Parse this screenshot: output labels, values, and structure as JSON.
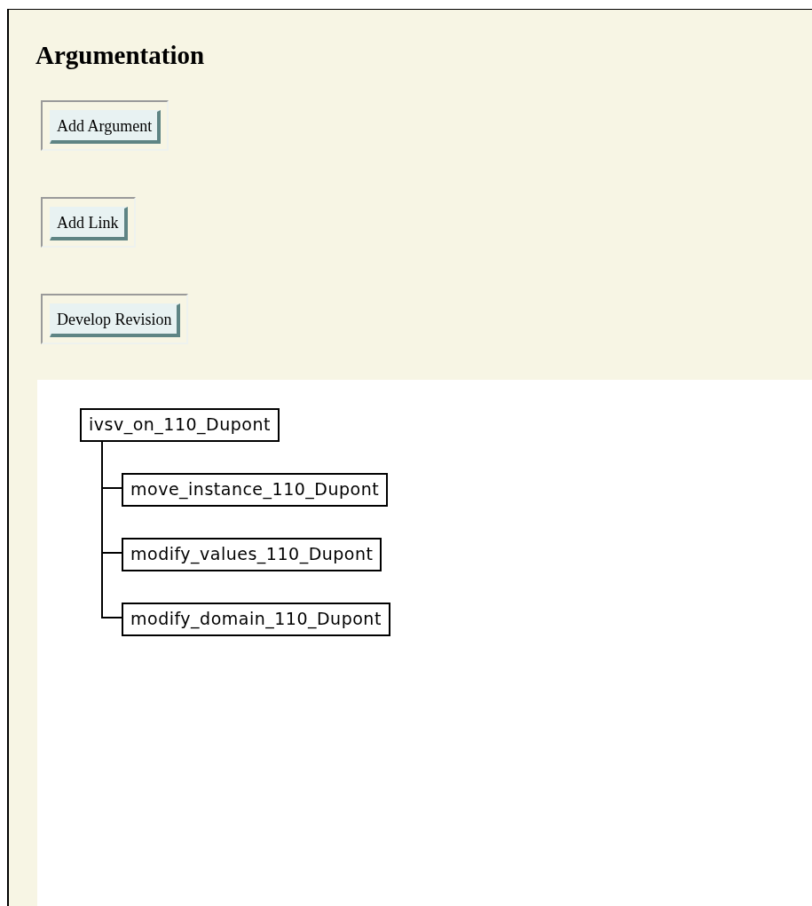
{
  "heading": "Argumentation",
  "buttons": [
    "Add Argument",
    "Add Link",
    "Develop Revision"
  ],
  "tree": {
    "label": "ivsv_on_110_Dupont",
    "children": [
      {
        "label": "move_instance_110_Dupont"
      },
      {
        "label": "modify_values_110_Dupont"
      },
      {
        "label": "modify_domain_110_Dupont"
      }
    ]
  }
}
